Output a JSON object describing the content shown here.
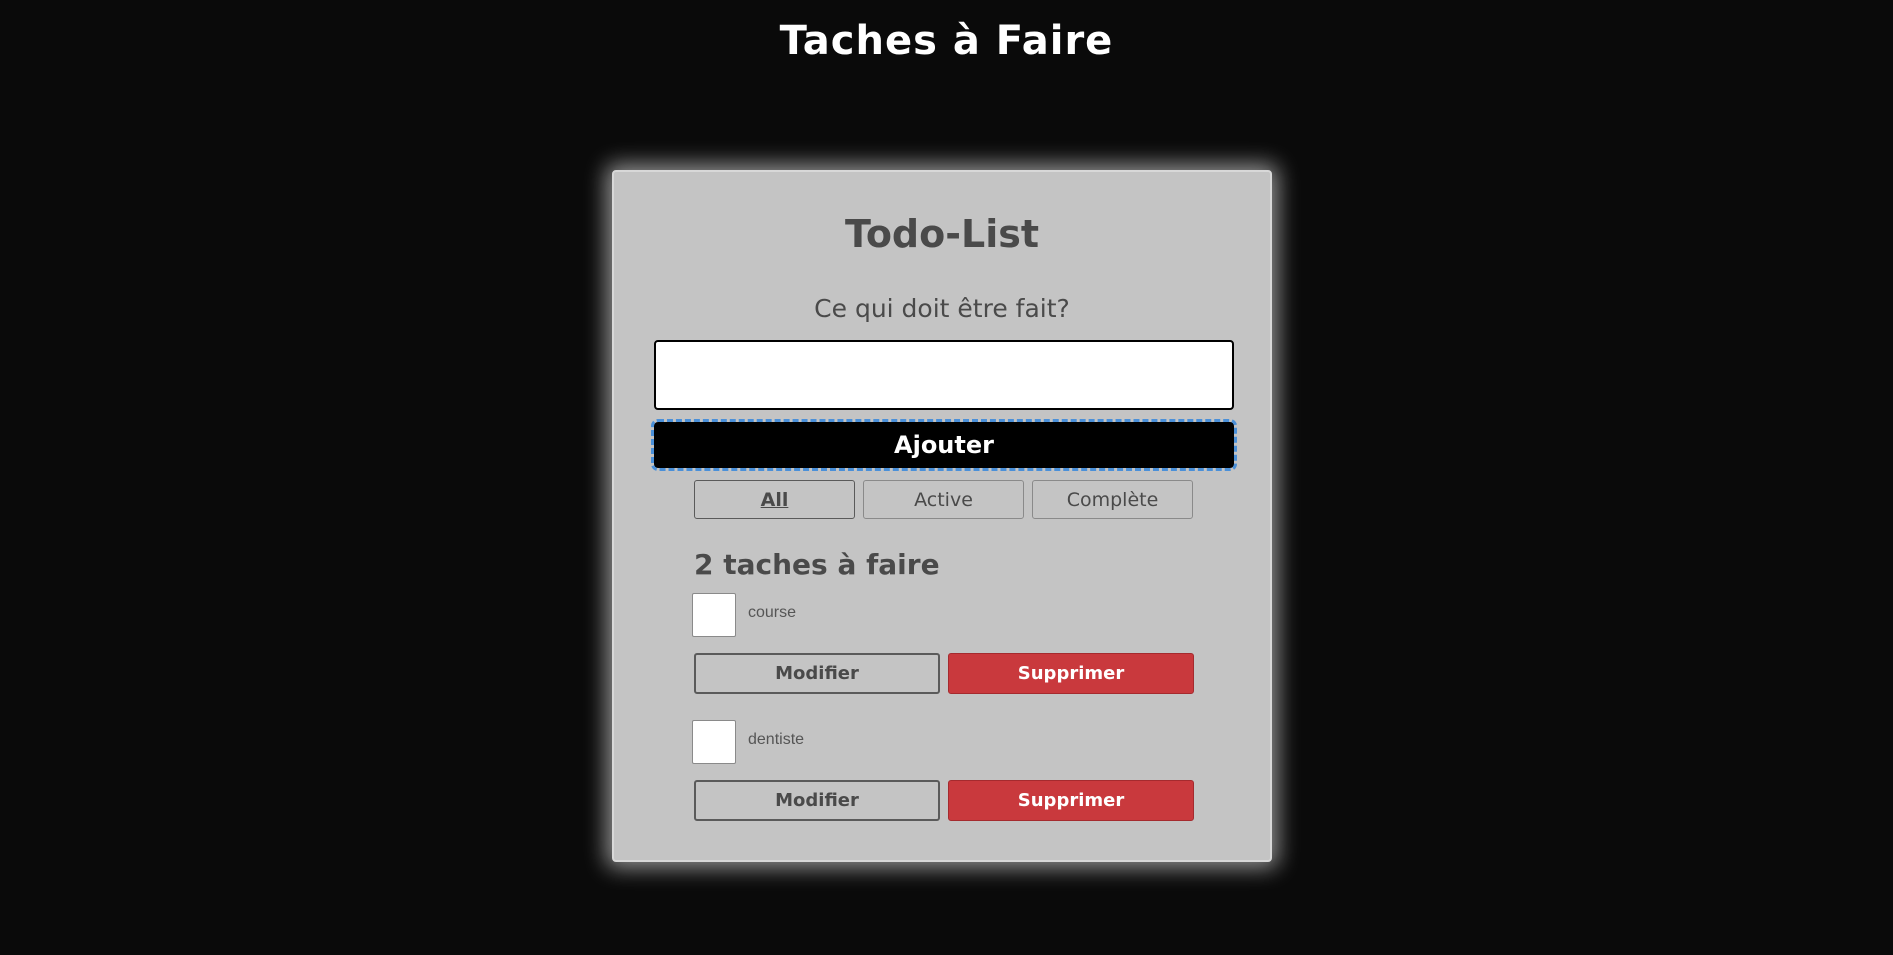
{
  "page": {
    "title": "Taches à Faire"
  },
  "card": {
    "title": "Todo-List",
    "question": "Ce qui doit être fait?",
    "input_value": "",
    "add_label": "Ajouter"
  },
  "filters": {
    "all": "All",
    "active": "Active",
    "complete": "Complète",
    "selected": "All"
  },
  "counter": "2 taches à faire",
  "tasks": [
    {
      "label": "course",
      "checked": false,
      "edit_label": "Modifier",
      "delete_label": "Supprimer"
    },
    {
      "label": "dentiste",
      "checked": false,
      "edit_label": "Modifier",
      "delete_label": "Supprimer"
    }
  ],
  "colors": {
    "background": "#0a0a0a",
    "card": "#c4c4c4",
    "text": "#4a4a4a",
    "add_button": "#000000",
    "delete_button": "#c9393d",
    "focus_outline": "#4a90d9"
  }
}
